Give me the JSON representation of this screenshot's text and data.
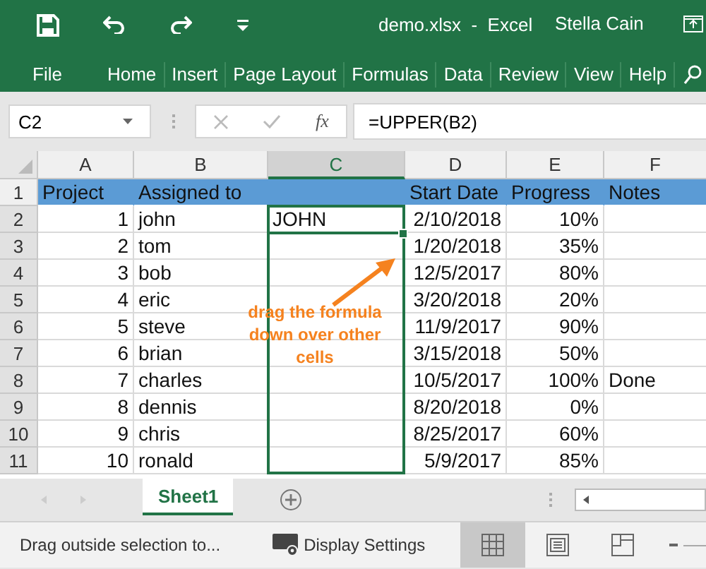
{
  "title_bar": {
    "title": "demo.xlsx  -  Excel",
    "user": "Stella Cain"
  },
  "ribbon_tabs": [
    "File",
    "Home",
    "Insert",
    "Page Layout",
    "Formulas",
    "Data",
    "Review",
    "View",
    "Help"
  ],
  "formula_bar": {
    "name_box": "C2",
    "function_label": "fx",
    "formula": "=UPPER(B2)"
  },
  "columns": [
    {
      "label": "A",
      "selected": false
    },
    {
      "label": "B",
      "selected": false
    },
    {
      "label": "C",
      "selected": true
    },
    {
      "label": "D",
      "selected": false
    },
    {
      "label": "E",
      "selected": false
    },
    {
      "label": "F",
      "selected": false
    }
  ],
  "rows": [
    {
      "number": "1",
      "selected": false,
      "header": true,
      "cells": [
        "Project",
        "Assigned to",
        null,
        "Start Date",
        "Progress",
        "Notes"
      ]
    },
    {
      "number": "2",
      "selected": true,
      "header": false,
      "cells": [
        "1",
        "john",
        "JOHN",
        "2/10/2018",
        "10%",
        null
      ]
    },
    {
      "number": "3",
      "selected": true,
      "header": false,
      "cells": [
        "2",
        "tom",
        null,
        "1/20/2018",
        "35%",
        null
      ]
    },
    {
      "number": "4",
      "selected": true,
      "header": false,
      "cells": [
        "3",
        "bob",
        null,
        "12/5/2017",
        "80%",
        null
      ]
    },
    {
      "number": "5",
      "selected": true,
      "header": false,
      "cells": [
        "4",
        "eric",
        null,
        "3/20/2018",
        "20%",
        null
      ]
    },
    {
      "number": "6",
      "selected": true,
      "header": false,
      "cells": [
        "5",
        "steve",
        null,
        "11/9/2017",
        "90%",
        null
      ]
    },
    {
      "number": "7",
      "selected": true,
      "header": false,
      "cells": [
        "6",
        "brian",
        null,
        "3/15/2018",
        "50%",
        null
      ]
    },
    {
      "number": "8",
      "selected": true,
      "header": false,
      "cells": [
        "7",
        "charles",
        null,
        "10/5/2017",
        "100%",
        "Done"
      ]
    },
    {
      "number": "9",
      "selected": true,
      "header": false,
      "cells": [
        "8",
        "dennis",
        null,
        "8/20/2018",
        "0%",
        null
      ]
    },
    {
      "number": "10",
      "selected": true,
      "header": false,
      "cells": [
        "9",
        "chris",
        null,
        "8/25/2017",
        "60%",
        null
      ]
    },
    {
      "number": "11",
      "selected": true,
      "header": false,
      "cells": [
        "10",
        "ronald",
        null,
        "5/9/2017",
        "85%",
        null
      ]
    }
  ],
  "annotation": "drag the formula down over other cells",
  "sheet_tabs": [
    {
      "label": "Sheet1",
      "selected": true
    }
  ],
  "status_bar": {
    "message": "Drag outside selection to...",
    "display_settings": "Display Settings",
    "view_buttons": [
      {
        "kind": "normal",
        "selected": true
      },
      {
        "kind": "page_layout",
        "selected": false
      },
      {
        "kind": "page_break",
        "selected": false
      }
    ]
  }
}
